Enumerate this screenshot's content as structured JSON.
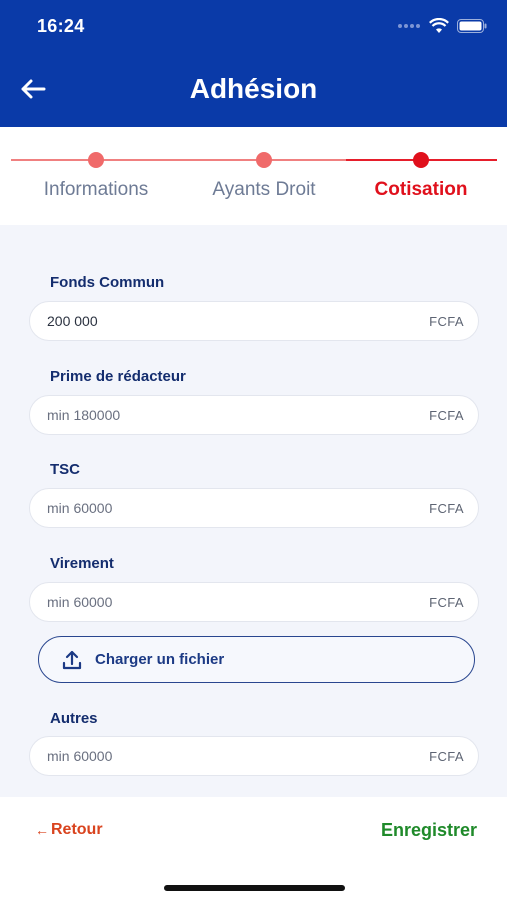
{
  "status_bar": {
    "time": "16:24"
  },
  "header": {
    "title": "Adhésion"
  },
  "stepper": {
    "steps": [
      {
        "label": "Informations",
        "active": false
      },
      {
        "label": "Ayants Droit",
        "active": false
      },
      {
        "label": "Cotisation",
        "active": true
      }
    ]
  },
  "form": {
    "fields": [
      {
        "label": "Fonds Commun",
        "value": "200 000",
        "placeholder": "",
        "unit": "FCFA"
      },
      {
        "label": "Prime de rédacteur",
        "value": "",
        "placeholder": "min 180000",
        "unit": "FCFA"
      },
      {
        "label": "TSC",
        "value": "",
        "placeholder": "min 60000",
        "unit": "FCFA"
      },
      {
        "label": "Virement",
        "value": "",
        "placeholder": "min 60000",
        "unit": "FCFA"
      },
      {
        "label": "Autres",
        "value": "",
        "placeholder": "min 60000",
        "unit": "FCFA"
      }
    ],
    "upload_label": "Charger un fichier"
  },
  "footer": {
    "back_label": "Retour",
    "save_label": "Enregistrer"
  },
  "colors": {
    "header_bg": "#0a3aa8",
    "accent_red": "#e0101c",
    "save_green": "#1f8a2a",
    "back_orange": "#d9431e"
  }
}
